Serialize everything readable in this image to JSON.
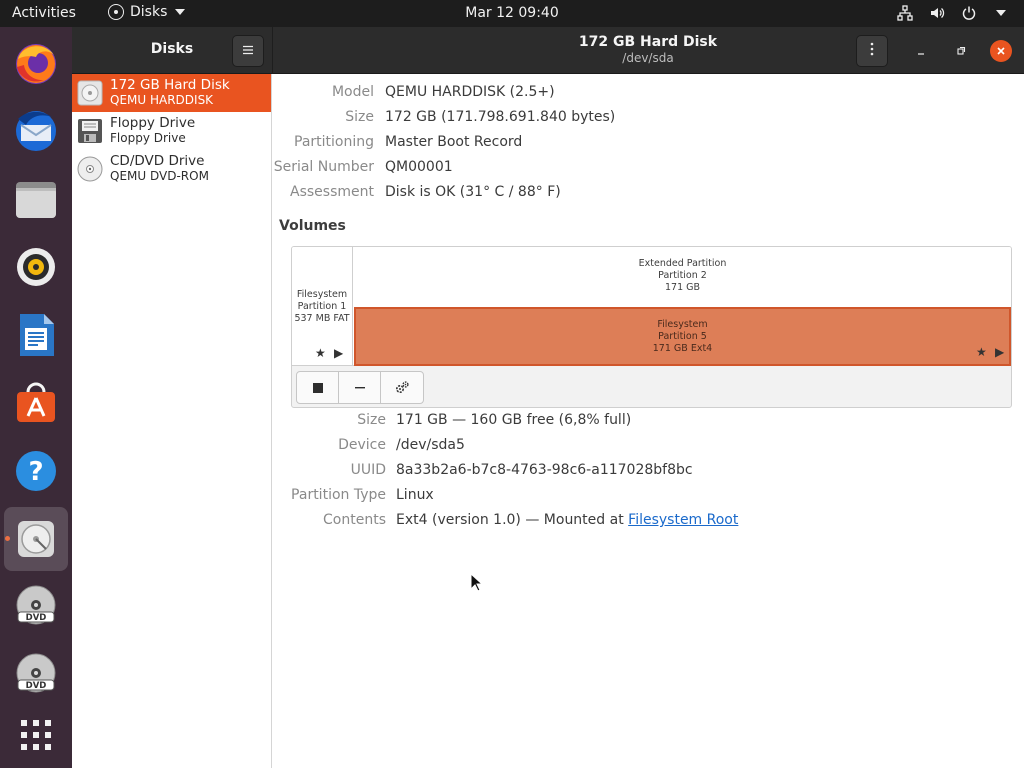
{
  "topbar": {
    "activities": "Activities",
    "app_name": "Disks",
    "clock": "Mar 12  09:40",
    "tray_icons": [
      "network-icon",
      "volume-icon",
      "power-icon",
      "caret-down-icon"
    ]
  },
  "dock": {
    "items": [
      "firefox-icon",
      "thunderbird-icon",
      "files-icon",
      "rhythmbox-icon",
      "libreoffice-writer-icon",
      "ubuntu-software-icon",
      "help-icon",
      "disks-icon",
      "dvd-icon",
      "dvd-icon",
      "show-apps-icon"
    ],
    "active": "disks-icon"
  },
  "window": {
    "sidebar_title": "Disks",
    "title": "172 GB Hard Disk",
    "subtitle": "/dev/sda"
  },
  "drives": [
    {
      "name": "172 GB Hard Disk",
      "sub": "QEMU HARDDISK",
      "icon": "hard-disk-icon"
    },
    {
      "name": "Floppy Drive",
      "sub": "Floppy Drive",
      "icon": "floppy-icon"
    },
    {
      "name": "CD/DVD Drive",
      "sub": "QEMU DVD-ROM",
      "icon": "optical-drive-icon"
    }
  ],
  "disk_info": [
    {
      "key": "Model",
      "value": "QEMU HARDDISK (2.5+)"
    },
    {
      "key": "Size",
      "value": "172 GB (171.798.691.840 bytes)"
    },
    {
      "key": "Partitioning",
      "value": "Master Boot Record"
    },
    {
      "key": "Serial Number",
      "value": "QM00001"
    },
    {
      "key": "Assessment",
      "value": "Disk is OK (31° C / 88° F)"
    }
  ],
  "volumes": {
    "title": "Volumes",
    "partition1": {
      "l1": "Filesystem",
      "l2": "Partition 1",
      "l3": "537 MB FAT"
    },
    "extended": {
      "l1": "Extended Partition",
      "l2": "Partition 2",
      "l3": "171 GB"
    },
    "partition5": {
      "l1": "Filesystem",
      "l2": "Partition 5",
      "l3": "171 GB Ext4"
    }
  },
  "partition_info": [
    {
      "key": "Size",
      "value": "171 GB — 160 GB free (6,8% full)"
    },
    {
      "key": "Device",
      "value": "/dev/sda5"
    },
    {
      "key": "UUID",
      "value": "8a33b2a6-b7c8-4763-98c6-a117028bf8bc"
    },
    {
      "key": "Partition Type",
      "value": "Linux"
    }
  ],
  "contents": {
    "key": "Contents",
    "value_prefix": "Ext4 (version 1.0) — Mounted at ",
    "link": "Filesystem Root"
  },
  "colors": {
    "accent": "#e95420",
    "partition_fill": "#dd7e57",
    "dock_bg": "#3b2a38",
    "link": "#1b6acb"
  }
}
